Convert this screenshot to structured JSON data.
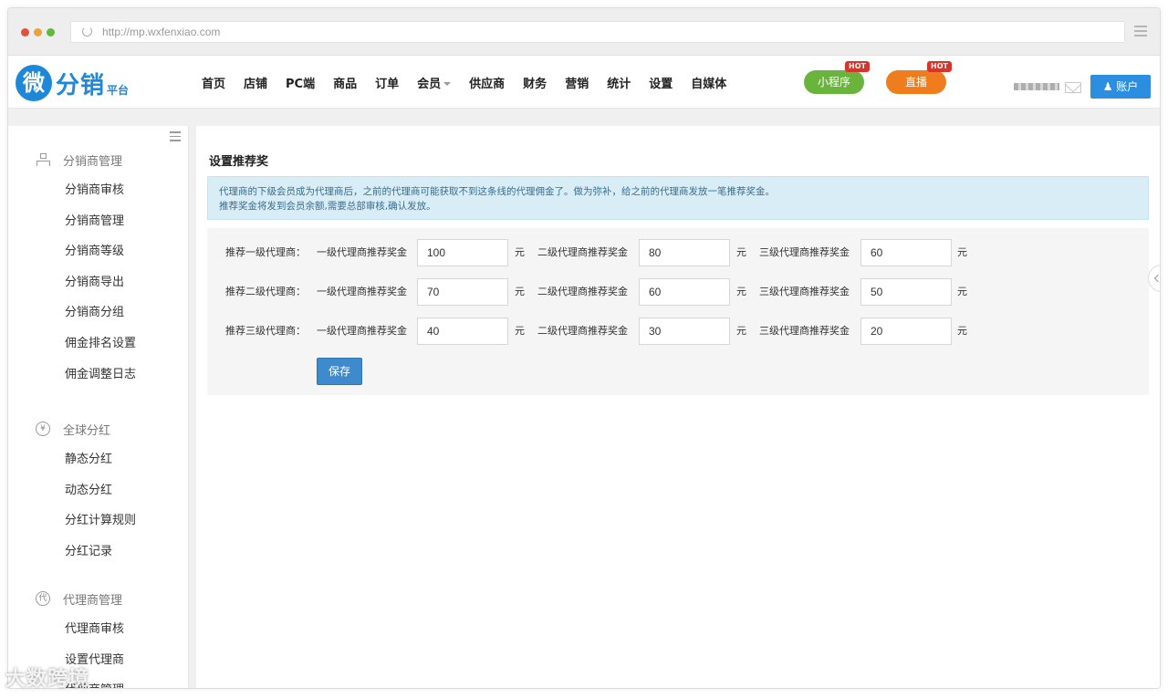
{
  "browser": {
    "url": "http://mp.wxfenxiao.com",
    "dot_colors": [
      "#e0533a",
      "#e9a33a",
      "#5dbb3b"
    ]
  },
  "header": {
    "logo_char": "微",
    "logo_brand": "分销",
    "logo_sub": "平台",
    "menu": [
      "首页",
      "店铺",
      "PC端",
      "商品",
      "订单",
      "会员",
      "供应商",
      "财务",
      "营销",
      "统计",
      "设置",
      "自媒体"
    ],
    "mini_program": {
      "label": "小程序",
      "badge": "HOT",
      "color": "#6ab43e"
    },
    "live": {
      "label": "直播",
      "badge": "HOT",
      "color": "#ef7d1d"
    },
    "account_label": "账户",
    "accent_color": "#2b8ee0"
  },
  "sidebar": {
    "groups": [
      {
        "icon": "org-tree-icon",
        "title": "分销商管理",
        "items": [
          "分销商审核",
          "分销商管理",
          "分销商等级",
          "分销商导出",
          "分销商分组",
          "佣金排名设置",
          "佣金调整日志"
        ]
      },
      {
        "icon": "yen-icon",
        "icon_char": "¥",
        "title": "全球分红",
        "items": [
          "静态分红",
          "动态分红",
          "分红计算规则",
          "分红记录"
        ]
      },
      {
        "icon": "agent-icon",
        "icon_char": "代",
        "title": "代理商管理",
        "items": [
          "代理商审核",
          "设置代理商",
          "代理商管理"
        ]
      }
    ]
  },
  "main": {
    "title": "设置推荐奖",
    "notice_line1": "代理商的下级会员成为代理商后，之前的代理商可能获取不到这条线的代理佣金了。做为弥补，给之前的代理商发放一笔推荐奖金。",
    "notice_line2": "推荐奖金将发到会员余额,需要总部审核,确认发放。",
    "rows": [
      {
        "label": "推荐一级代理商：",
        "fields": [
          {
            "label": "一级代理商推荐奖金",
            "value": "100",
            "unit": "元"
          },
          {
            "label": "二级代理商推荐奖金",
            "value": "80",
            "unit": "元"
          },
          {
            "label": "三级代理商推荐奖金",
            "value": "60",
            "unit": "元"
          }
        ]
      },
      {
        "label": "推荐二级代理商：",
        "fields": [
          {
            "label": "一级代理商推荐奖金",
            "value": "70",
            "unit": "元"
          },
          {
            "label": "二级代理商推荐奖金",
            "value": "60",
            "unit": "元"
          },
          {
            "label": "三级代理商推荐奖金",
            "value": "50",
            "unit": "元"
          }
        ]
      },
      {
        "label": "推荐三级代理商：",
        "fields": [
          {
            "label": "一级代理商推荐奖金",
            "value": "40",
            "unit": "元"
          },
          {
            "label": "二级代理商推荐奖金",
            "value": "30",
            "unit": "元"
          },
          {
            "label": "三级代理商推荐奖金",
            "value": "20",
            "unit": "元"
          }
        ]
      }
    ],
    "save_label": "保存"
  },
  "watermark": "大数跨境"
}
